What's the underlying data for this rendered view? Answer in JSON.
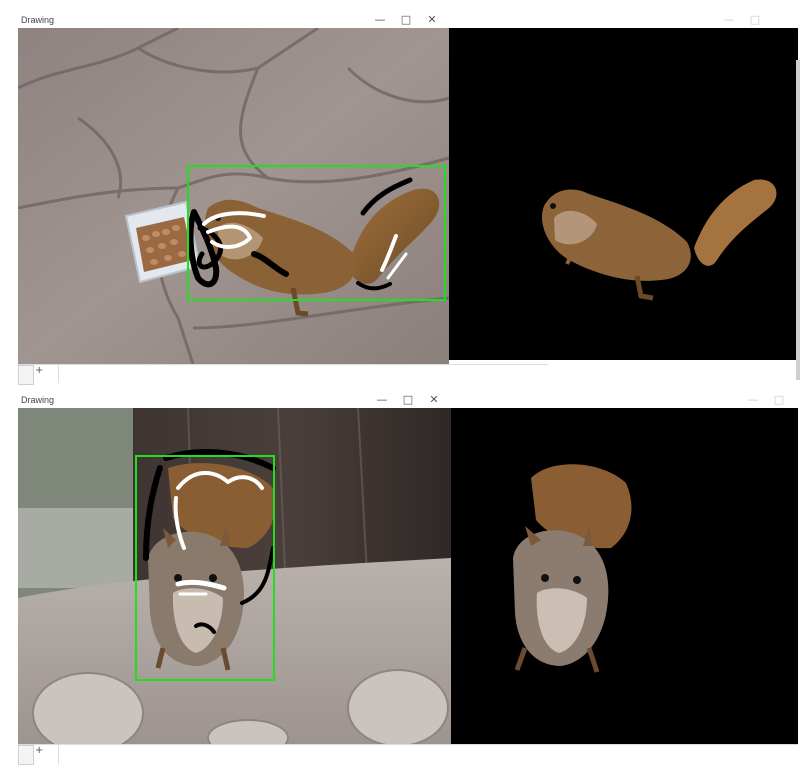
{
  "window_top_left": {
    "title": "Drawing",
    "minimize": "—",
    "maximize": "□",
    "close": "✕"
  },
  "window_top_right": {
    "minimize": "—",
    "maximize": "□"
  },
  "window_bottom_left": {
    "title": "Drawing",
    "minimize": "—",
    "maximize": "□",
    "close": "✕"
  },
  "window_bottom_right": {
    "minimize": "—",
    "maximize": "□"
  },
  "sheet_bar_top": {
    "add_label": "+"
  },
  "sheet_bar_bottom": {
    "add_label": "+"
  },
  "colors": {
    "bounding_box": "#22dd22",
    "mask_background": "#000000",
    "foreground_scribble": "#ffffff",
    "background_scribble": "#000000"
  }
}
